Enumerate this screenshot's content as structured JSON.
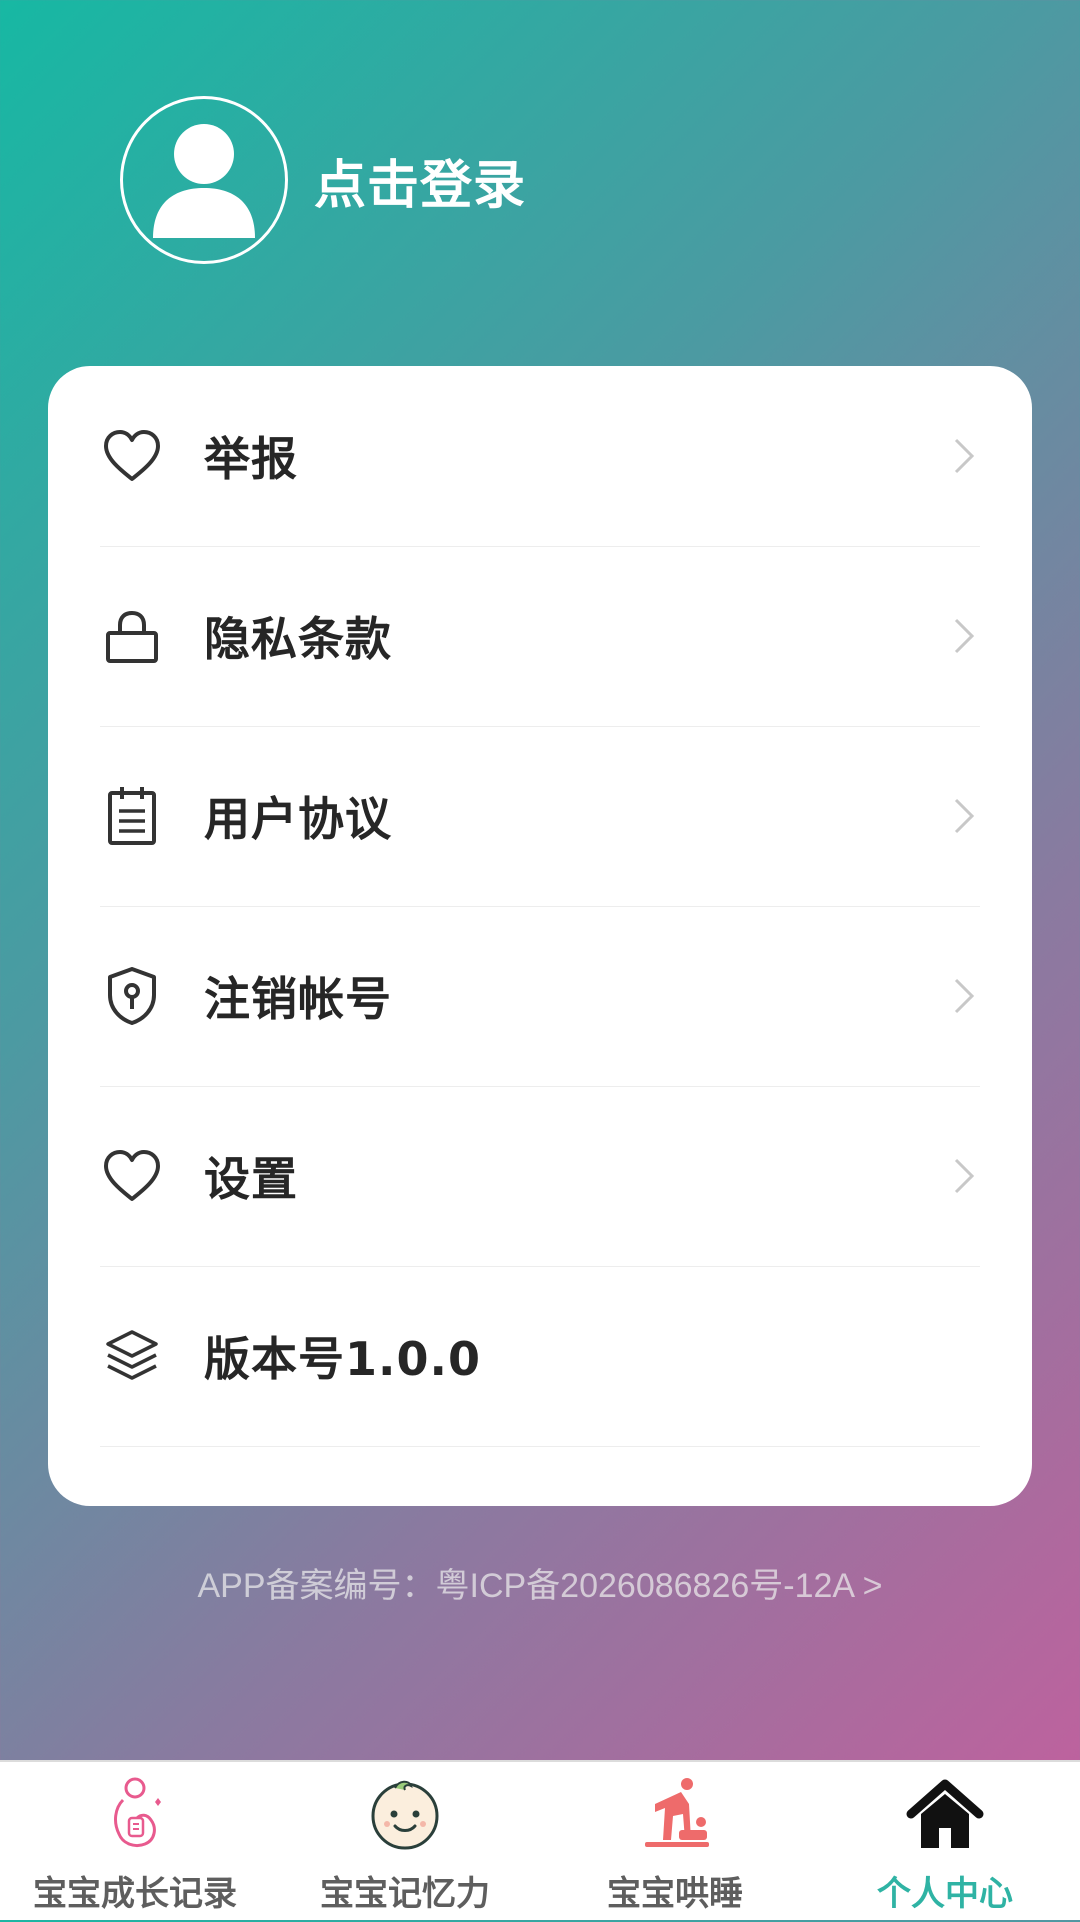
{
  "header": {
    "login_text": "点击登录",
    "avatar_icon": "user-avatar-icon"
  },
  "menu": {
    "items": [
      {
        "label": "举报",
        "icon": "heart-icon"
      },
      {
        "label": "隐私条款",
        "icon": "lock-icon"
      },
      {
        "label": "用户协议",
        "icon": "document-icon"
      },
      {
        "label": "注销帐号",
        "icon": "shield-key-icon"
      },
      {
        "label": "设置",
        "icon": "heart-icon"
      },
      {
        "label": "版本号1.0.0",
        "icon": "layers-icon"
      }
    ]
  },
  "footer": {
    "icp_text": "APP备案编号：粤ICP备2026086826号-12A >"
  },
  "tabbar": {
    "active_index": 3,
    "active_color": "#2fb3a4",
    "tabs": [
      {
        "label": "宝宝成长记录",
        "icon": "pregnant-mother-icon"
      },
      {
        "label": "宝宝记忆力",
        "icon": "baby-face-icon"
      },
      {
        "label": "宝宝哄睡",
        "icon": "diaper-change-icon"
      },
      {
        "label": "个人中心",
        "icon": "home-icon"
      }
    ]
  },
  "colors": {
    "gradient_start": "#17b8a3",
    "gradient_end": "#c65e9d",
    "card": "#ffffff"
  }
}
